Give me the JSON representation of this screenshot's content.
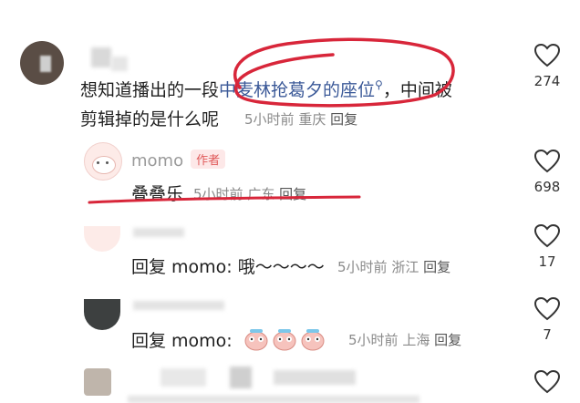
{
  "comment1": {
    "text_line1_prefix": "想知道播出的一段",
    "link_text": "中麦林抢葛夕的座位",
    "text_line1_suffix": "，中间被",
    "text_line2": "剪辑掉的是什么呢",
    "time": "5小时前",
    "location": "重庆",
    "reply_label": "回复",
    "likes": "274"
  },
  "comment2": {
    "username": "momo",
    "badge": "作者",
    "text": "叠叠乐",
    "time": "5小时前",
    "location": "广东",
    "reply_label": "回复",
    "likes": "698"
  },
  "comment3": {
    "text": "回复 momo: 哦～～～～",
    "time": "5小时前",
    "location": "浙江",
    "reply_label": "回复",
    "likes": "17"
  },
  "comment4": {
    "text": "回复 momo:",
    "time": "5小时前",
    "location": "上海",
    "reply_label": "回复",
    "likes": "7"
  },
  "icons": {
    "like": "heart-outline-icon",
    "search": "magnifier-icon"
  },
  "colors": {
    "annotation_red": "#d8263a",
    "link_blue": "#3b5998",
    "badge_red": "#e05a5a"
  }
}
